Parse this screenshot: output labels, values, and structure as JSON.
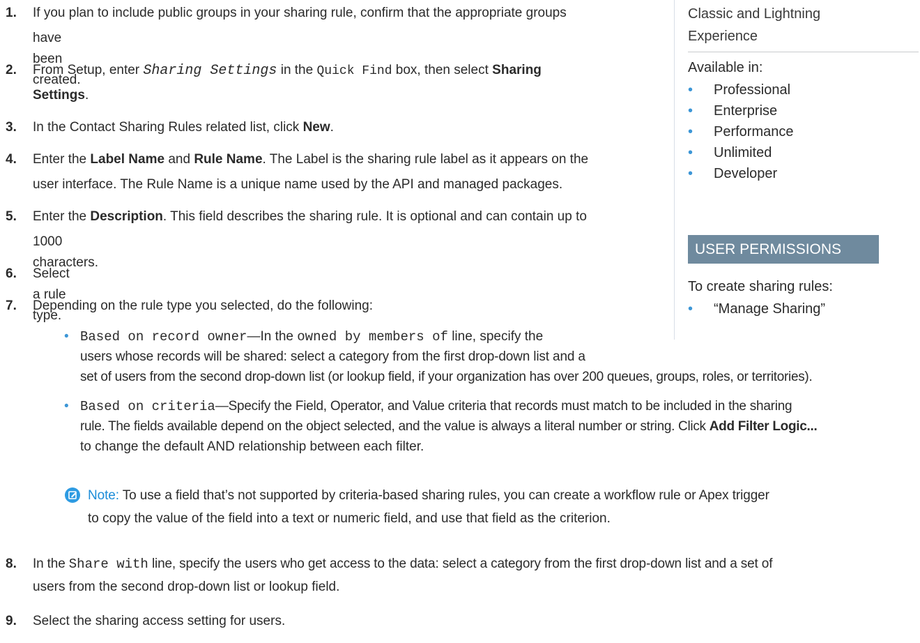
{
  "steps": [
    {
      "num": "1.",
      "line1": "If you plan to include public groups in your sharing rule, confirm that the appropriate groups",
      "line2": "have been created."
    },
    {
      "num": "2.",
      "pre": "From Setup, enter ",
      "code1": "Sharing Settings",
      "mid": " in the ",
      "code2": "Quick Find",
      "post": " box, then select ",
      "bold1": "Sharing",
      "bold2": "Settings",
      "end": "."
    },
    {
      "num": "3.",
      "pre": "In the Contact Sharing Rules related list, click ",
      "bold": "New",
      "end": "."
    },
    {
      "num": "4.",
      "pre": "Enter the ",
      "bold1": "Label Name",
      "mid": " and ",
      "bold2": "Rule Name",
      "post": ". The Label is the sharing rule label as it appears on the",
      "line2": "user interface. The Rule Name is a unique name used by the API and managed packages."
    },
    {
      "num": "5.",
      "pre": "Enter the ",
      "bold": "Description",
      "post": ". This field describes the sharing rule. It is optional and can contain up to",
      "line2": "1000 characters."
    },
    {
      "num": "6.",
      "text": "Select a rule type."
    },
    {
      "num": "7.",
      "text": "Depending on the rule type you selected, do the following:"
    },
    {
      "num": "8.",
      "pre": "In the ",
      "code": "Share with",
      "post": " line, specify the users who get access to the data: select a category from the first drop-down list and a set of",
      "line2": "users from the second drop-down list or lookup field."
    },
    {
      "num": "9.",
      "text": "Select the sharing access setting for users."
    }
  ],
  "bullets": {
    "owner": {
      "code1": "Based on record owner",
      "mid1": "—In the ",
      "code2": "owned by members of",
      "post1": " line, specify the",
      "line2": "users whose records will be shared: select a category from the first drop-down list and a",
      "line3": "set of users from the second drop-down list (or lookup field, if your organization has over 200 queues, groups, roles, or territories)."
    },
    "criteria": {
      "code": "Based on criteria",
      "post1": "—Specify the Field, Operator, and Value criteria that records must match to be included in the sharing",
      "line2": "rule. The fields available depend on the object selected, and the value is always a literal number or string. Click ",
      "bold": "Add Filter Logic...",
      "line3": "to change the default AND relationship between each filter."
    }
  },
  "note": {
    "label": "Note:",
    "line1": " To use a field that’s not supported by criteria-based sharing rules, you can create a workflow rule or Apex trigger",
    "line2": "to copy the value of the field into a text or numeric field, and use that field as the criterion."
  },
  "sidebar": {
    "edition_line1": "Classic and Lightning",
    "edition_line2": "Experience",
    "available_label": "Available in:",
    "editions": [
      "Professional",
      "Enterprise",
      "Performance",
      "Unlimited",
      "Developer"
    ],
    "permissions_header": "USER PERMISSIONS",
    "create_label": "To create sharing rules:",
    "permissions": [
      "“Manage Sharing”"
    ],
    "bullet_color": "#3c96d6",
    "header_color": "#6f8a9e"
  },
  "icons": {
    "note": "edit-note-icon"
  }
}
